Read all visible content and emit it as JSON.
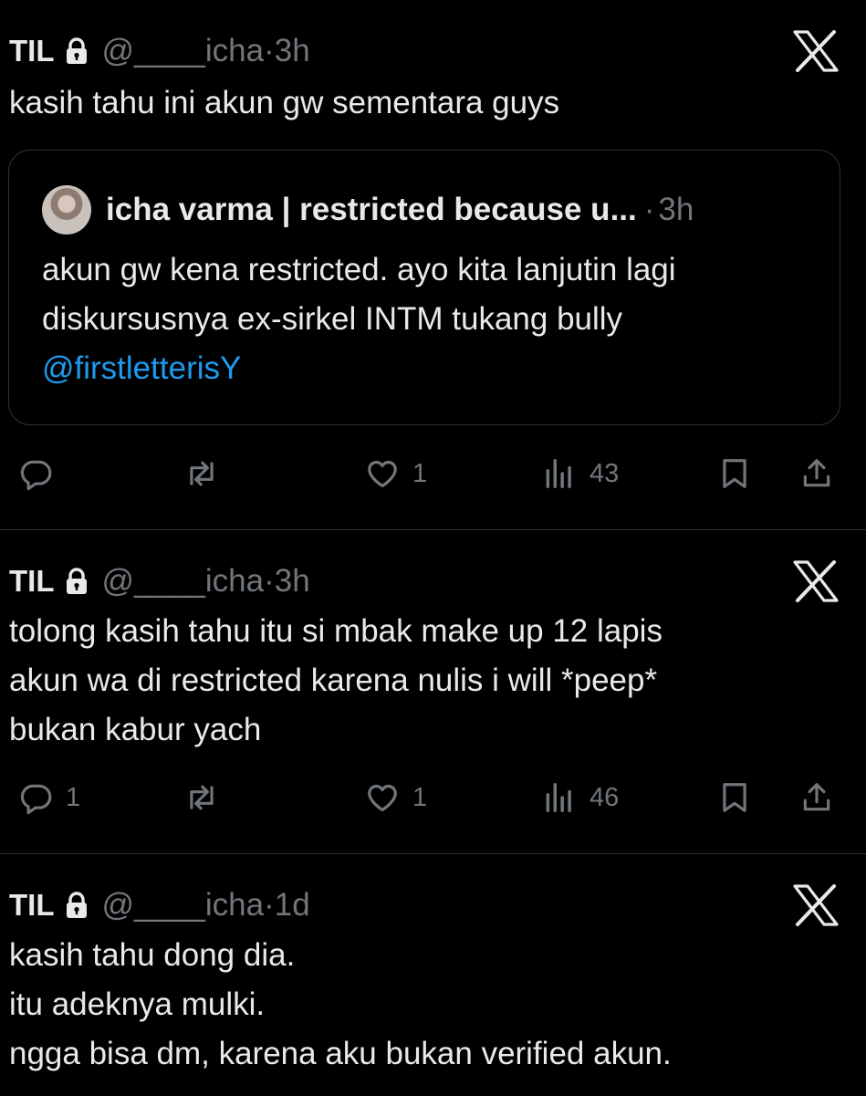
{
  "tweets": [
    {
      "name": "TIL",
      "handle": "@____icha",
      "time": "3h",
      "text": "kasih tahu ini akun gw sementara guys",
      "quote": {
        "name": "icha varma | restricted because u...",
        "time": "3h",
        "text_before": "akun gw kena restricted. ayo kita lanjutin lagi diskursusnya ex-sirkel INTM tukang bully ",
        "mention": "@firstletterisY"
      },
      "replies": "",
      "likes": "1",
      "views": "43"
    },
    {
      "name": "TIL",
      "handle": "@____icha",
      "time": "3h",
      "text": "tolong kasih tahu itu si mbak make up 12 lapis\nakun wa di restricted karena nulis i will *peep*\nbukan kabur yach",
      "replies": "1",
      "likes": "1",
      "views": "46"
    },
    {
      "name": "TIL",
      "handle": "@____icha",
      "time": "1d",
      "text": "kasih tahu dong dia.\nitu adeknya mulki.\nngga bisa dm, karena aku bukan verified akun."
    }
  ],
  "icons": {
    "lock": "lock-icon",
    "logo": "x-logo-icon",
    "reply": "reply-icon",
    "repost": "repost-icon",
    "like": "heart-icon",
    "views": "views-icon",
    "bookmark": "bookmark-icon",
    "share": "share-icon"
  },
  "colors": {
    "background": "#000000",
    "text": "#e7e9ea",
    "muted": "#71767b",
    "link": "#1d9bf0",
    "border": "#2f3336"
  }
}
